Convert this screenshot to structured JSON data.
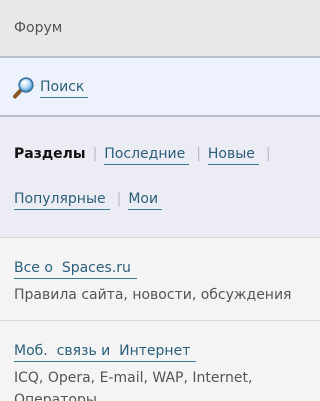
{
  "header": {
    "title": "Форум"
  },
  "search": {
    "label": "Поиск",
    "icon": "magnifier-icon"
  },
  "sections": {
    "current": "Разделы",
    "links": [
      "Последние",
      "Новые",
      "Популярные",
      "Мои"
    ]
  },
  "forums": [
    {
      "name": "Все о  Spaces.ru",
      "description": "Правила сайта, новости, обсуждения"
    },
    {
      "name": "Моб.  связь и  Интернет",
      "description": "ICQ, Opera, E-mail, WAP, Internet, Операторы"
    }
  ],
  "colors": {
    "link": "#2c5f7c",
    "header_bg": "#e8e8e8",
    "search_bg": "#eef2fc",
    "sections_bg": "#ececf5",
    "item_bg": "#f4f4f4"
  }
}
